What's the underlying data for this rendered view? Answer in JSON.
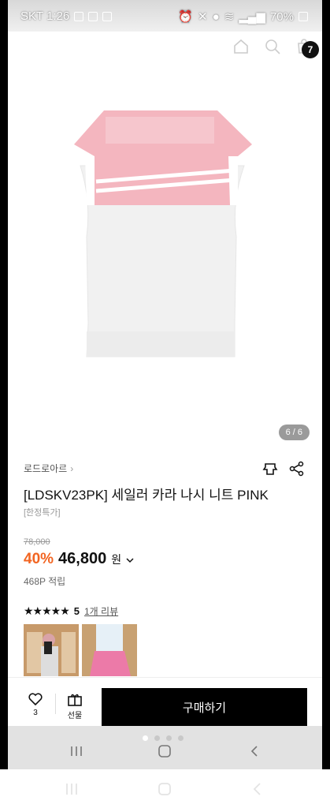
{
  "status_bar": {
    "carrier_time": "SKT 1:26",
    "battery": "70%"
  },
  "header": {
    "cart_count": "7"
  },
  "gallery": {
    "counter": "6 / 6"
  },
  "product": {
    "brand": "로드로아르",
    "title": "[LDSKV23PK] 세일러 카라 나시 니트 PINK",
    "tag": "[한정특가]",
    "original_price": "78,000",
    "discount": "40%",
    "price": "46,800",
    "currency": "원",
    "points": "468P 적립"
  },
  "reviews": {
    "stars": "★★★★★",
    "score": "5",
    "link": "1개 리뷰"
  },
  "bottom_bar": {
    "like_count": "3",
    "gift_label": "선물",
    "buy_label": "구매하기"
  },
  "colors": {
    "accent": "#f26522",
    "collar_pink": "#f4b6bf",
    "button": "#000000"
  }
}
